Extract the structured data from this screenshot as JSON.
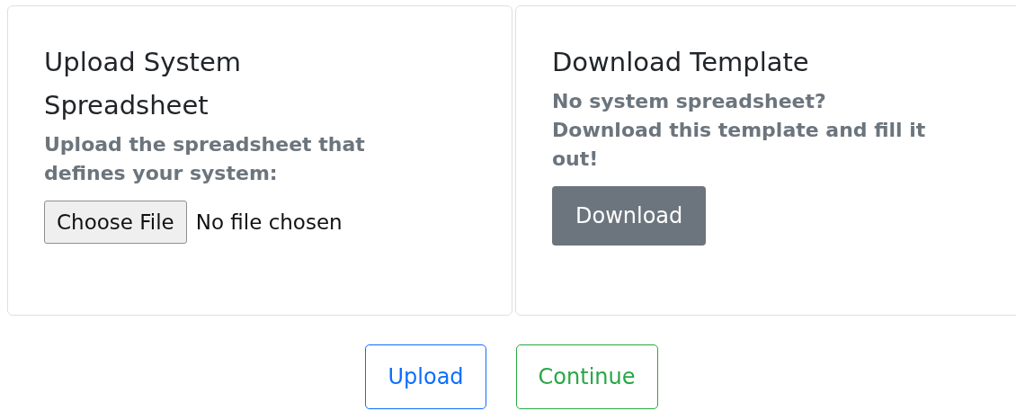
{
  "cards": [
    {
      "kind": "upload",
      "title": [
        "Upload System",
        "Spreadsheet"
      ],
      "description": [
        "Upload the spreadsheet that",
        "defines your system:"
      ],
      "file_button": "Choose File",
      "file_status": "No file chosen"
    },
    {
      "kind": "download",
      "title": [
        "Download Template"
      ],
      "description": [
        "No system spreadsheet?",
        "Download this template and fill it",
        "out!"
      ],
      "button": "Download"
    }
  ],
  "actions": [
    {
      "label": "Upload",
      "kind": "primary"
    },
    {
      "label": "Continue",
      "kind": "success"
    }
  ]
}
